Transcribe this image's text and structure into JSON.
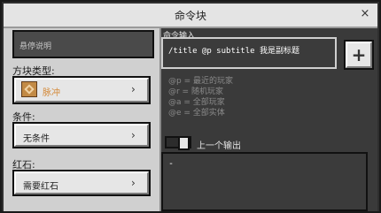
{
  "window": {
    "title": "命令块",
    "close_symbol": "×"
  },
  "left": {
    "hover_placeholder": "悬停说明",
    "block_type": {
      "label": "方块类型:",
      "value": "脉冲"
    },
    "condition": {
      "label": "条件:",
      "value": "无条件"
    },
    "redstone": {
      "label": "红石:",
      "value": "需要红石"
    },
    "chevron": "›"
  },
  "right": {
    "command_input_label": "命令输入",
    "command_text": "/title @p subtitle 我是副标题",
    "plus_button": "+",
    "help_lines": [
      "@p = 最近的玩家",
      "@r = 随机玩家",
      "@a = 全部玩家",
      "@e = 全部实体"
    ],
    "previous_output_label": "上一个输出",
    "output_text": "-"
  },
  "colors": {
    "orange_value": "#d48a3a"
  },
  "icons": {
    "pulse_block": "command-block-icon"
  }
}
